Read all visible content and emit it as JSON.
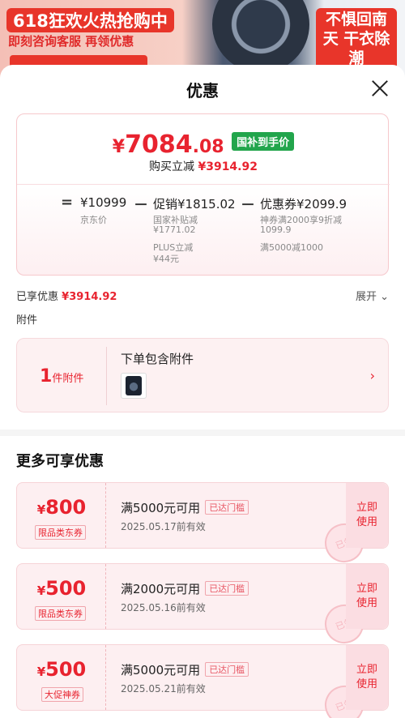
{
  "banner": {
    "headline": "618狂欢火热抢购中",
    "subline": "即刻咨询客服 再领优惠",
    "right_text": "不惧回南天 干衣除潮"
  },
  "sheet": {
    "title": "优惠"
  },
  "price": {
    "currency": "¥",
    "final_int": "7084",
    "final_dec": ".08",
    "gov_badge": "国补到手价",
    "buy_reduce_label": "购买立减",
    "buy_reduce_amount": "¥3914.92"
  },
  "breakdown": {
    "eq": "=",
    "jd_price": "¥10999",
    "jd_label": "京东价",
    "minus1": "－",
    "promo_label_value": "促销¥1815.02",
    "promo_sub1": "国家补贴减",
    "promo_sub1_val": "¥1771.02",
    "promo_sub2": "PLUS立减",
    "promo_sub2_val": "¥44元",
    "minus2": "－",
    "coupon_label_value": "优惠券¥2099.9",
    "coupon_sub1": "神券满2000享9折减",
    "coupon_sub1_val": "1099.9",
    "coupon_sub2": "满5000减1000"
  },
  "enjoyed": {
    "label": "已享优惠",
    "amount": "¥3914.92",
    "expand": "展开"
  },
  "accessory": {
    "label": "附件",
    "count": "1",
    "unit": "件附件",
    "text": "下单包含附件"
  },
  "more_title": "更多可享优惠",
  "coupons": [
    {
      "cur": "¥",
      "amount": "800",
      "tag": "限品类东券",
      "cond": "满5000元可用",
      "met": "已达门槛",
      "date": "2025.05.17前有效",
      "use": "立即使用",
      "stamp": "已领"
    },
    {
      "cur": "¥",
      "amount": "500",
      "tag": "限品类东券",
      "cond": "满2000元可用",
      "met": "已达门槛",
      "date": "2025.05.16前有效",
      "use": "立即使用",
      "stamp": "已领"
    },
    {
      "cur": "¥",
      "amount": "500",
      "tag": "大促神券",
      "cond": "满5000元可用",
      "met": "已达门槛",
      "date": "2025.05.21前有效",
      "use": "立即使用",
      "stamp": "已领"
    }
  ],
  "colors": {
    "accent": "#e8232f",
    "badge_green": "#22a54c"
  }
}
